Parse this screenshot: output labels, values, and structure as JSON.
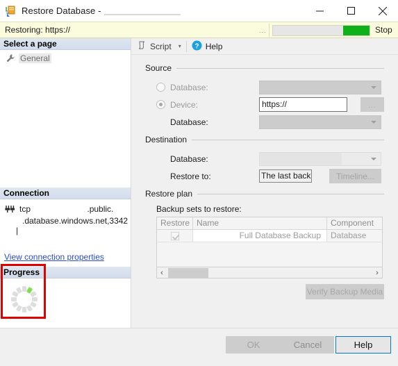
{
  "window": {
    "title": "Restore Database -",
    "icon": "restore-database-icon",
    "minimize_label": "–",
    "maximize_label": "☐",
    "close_label": "✕"
  },
  "status": {
    "text": "Restoring: https://",
    "ellipsis": "...",
    "stop_label": "Stop",
    "progress_percent": 73,
    "progress_color": "#0fb019",
    "background_color": "#fbfbdd"
  },
  "sidebar": {
    "select_page_header": "Select a page",
    "pages": [
      {
        "label": "General",
        "icon": "wrench-icon",
        "selected": true
      }
    ],
    "connection_header": "Connection",
    "connection": {
      "icon": "plug-icon",
      "line1_prefix": "tcp",
      "line1_suffix": ".public.",
      "line2": ".database.windows.net,3342",
      "redaction_marks": "|            |"
    },
    "view_connection_properties": "View connection properties",
    "progress_header": "Progress",
    "progress_spinner": "spinner-icon"
  },
  "toolbar": {
    "script_label": "Script",
    "script_icon": "script-icon",
    "script_caret": "▾",
    "help_label": "Help",
    "help_icon": "help-circle-icon"
  },
  "source": {
    "group_title": "Source",
    "database_radio_label": "Database:",
    "database_radio_selected": false,
    "database_combo_value": "",
    "device_radio_label": "Device:",
    "device_radio_selected": true,
    "device_value": "https://",
    "browse_label": "...",
    "device_database_label": "Database:",
    "device_database_value": ""
  },
  "destination": {
    "group_title": "Destination",
    "database_label": "Database:",
    "database_value": "",
    "restore_to_label": "Restore to:",
    "restore_to_value": "The last back",
    "timeline_label": "Timeline..."
  },
  "restore_plan": {
    "group_title": "Restore plan",
    "backup_sets_label": "Backup sets to restore:",
    "columns": [
      "Restore",
      "Name",
      "Component"
    ],
    "rows": [
      {
        "restore_checked": true,
        "name": "Full Database Backup",
        "component": "Database"
      }
    ],
    "scroll_left_arrow": "‹",
    "scroll_right_arrow": "›",
    "verify_backup_media_label": "Verify Backup Media"
  },
  "footer": {
    "ok_label": "OK",
    "cancel_label": "Cancel",
    "help_label": "Help"
  }
}
